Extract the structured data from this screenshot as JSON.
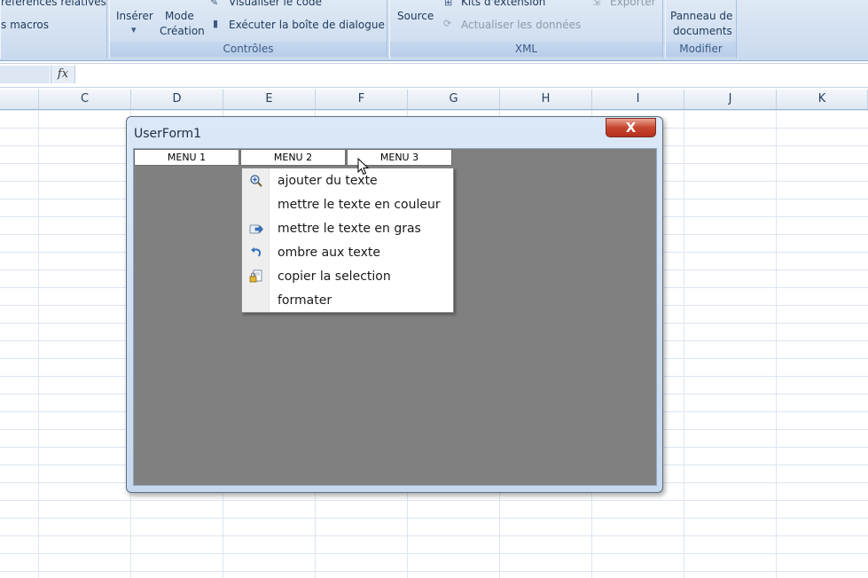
{
  "ribbon": {
    "code_group": {
      "references_relatives": "références relatives",
      "macros": "s macros"
    },
    "controls_group": {
      "inserer": "Insérer",
      "mode": "Mode",
      "creation": "Création",
      "visualiser_code": "Visualiser le code",
      "executer_dialogue": "Exécuter la boîte de dialogue",
      "label": "Contrôles"
    },
    "xml_group": {
      "source": "Source",
      "kits_extension": "Kits d'extension",
      "actualiser": "Actualiser les données",
      "exporter": "Exporter",
      "label": "XML"
    },
    "modifier_group": {
      "panneau": "Panneau de",
      "documents": "documents",
      "label": "Modifier"
    }
  },
  "formula_bar": {
    "fx": "fx",
    "value": ""
  },
  "columns": [
    "C",
    "D",
    "E",
    "F",
    "G",
    "H",
    "I",
    "J",
    "K"
  ],
  "userform": {
    "title": "UserForm1",
    "close_symbol": "X",
    "menus": [
      "MENU 1",
      "MENU 2",
      "MENU 3"
    ],
    "dropdown_items": [
      {
        "label": "ajouter du texte",
        "icon": "zoom-in-icon"
      },
      {
        "label": "mettre le texte en couleur",
        "icon": ""
      },
      {
        "label": "mettre le texte en gras",
        "icon": "forward-arrow-icon"
      },
      {
        "label": "ombre aux texte",
        "icon": "undo-icon"
      },
      {
        "label": "copier la selection",
        "icon": "lock-document-icon"
      },
      {
        "label": "formater",
        "icon": ""
      }
    ]
  },
  "colors": {
    "ribbon_bg": "#c9d9ee",
    "form_client": "#808080",
    "close_red": "#c8452f"
  }
}
